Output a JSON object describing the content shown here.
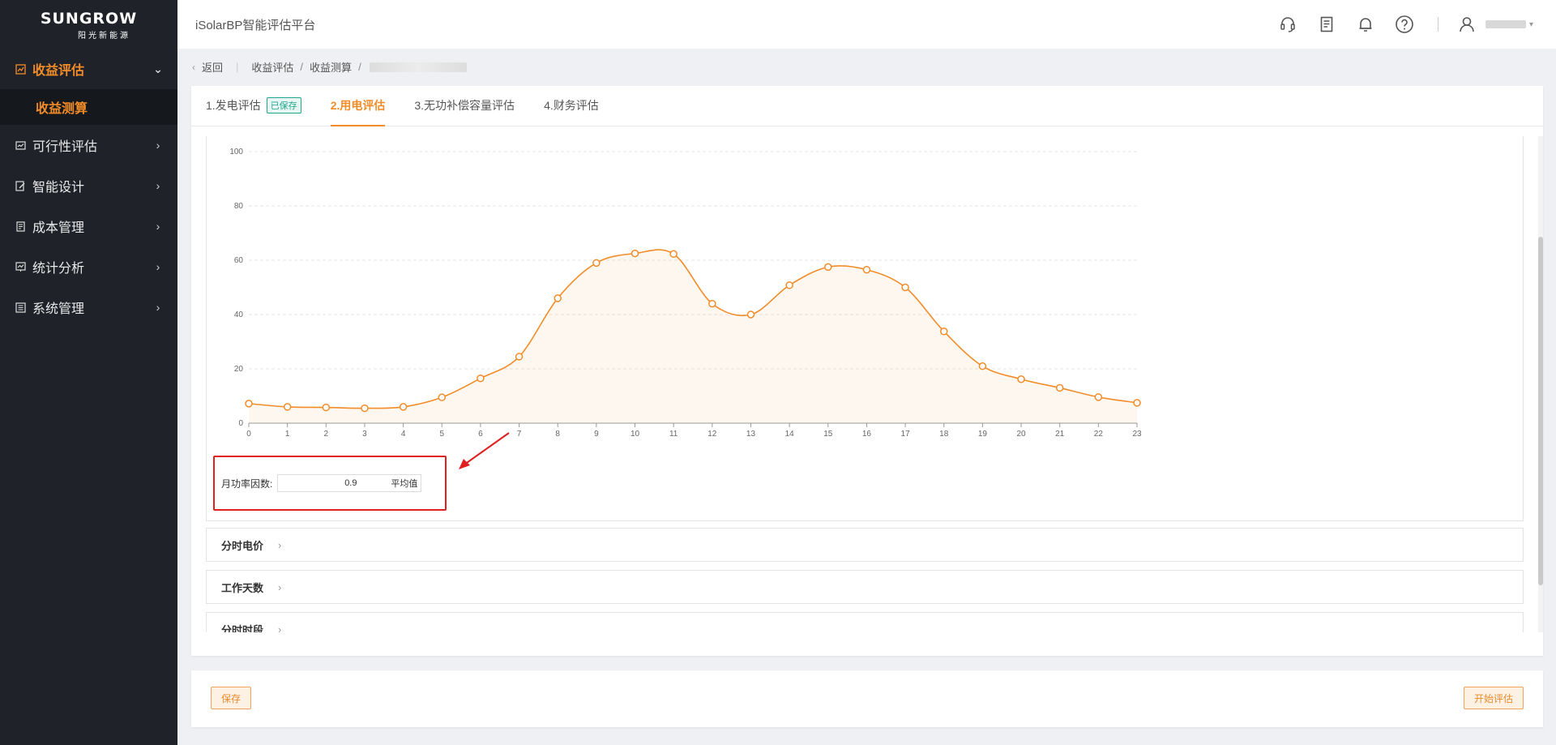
{
  "brand": {
    "name": "SUNGROW",
    "subtitle": "阳光新能源"
  },
  "app": {
    "title": "iSolarBP智能评估平台"
  },
  "sidebar": {
    "items": [
      {
        "label": "收益评估",
        "icon": "chart-icon",
        "active": true,
        "expanded": true
      },
      {
        "label": "可行性评估",
        "icon": "feasibility-icon"
      },
      {
        "label": "智能设计",
        "icon": "design-icon"
      },
      {
        "label": "成本管理",
        "icon": "cost-icon"
      },
      {
        "label": "统计分析",
        "icon": "stats-icon"
      },
      {
        "label": "系统管理",
        "icon": "settings-icon"
      }
    ],
    "subitem": {
      "label": "收益测算"
    }
  },
  "breadcrumb": {
    "back": "返回",
    "path": [
      "收益评估",
      "收益测算"
    ]
  },
  "tabs": [
    {
      "label": "1.发电评估",
      "badge": "已保存"
    },
    {
      "label": "2.用电评估",
      "active": true
    },
    {
      "label": "3.无功补偿容量评估"
    },
    {
      "label": "4.财务评估"
    }
  ],
  "power_factor": {
    "label": "月功率因数:",
    "value": "0.9",
    "unit": "平均值"
  },
  "sections": [
    {
      "label": "分时电价"
    },
    {
      "label": "工作天数"
    },
    {
      "label": "分时时段"
    }
  ],
  "footer": {
    "save": "保存",
    "start": "开始评估"
  },
  "colors": {
    "accent": "#f28c28",
    "sidebar_bg": "#1f2329",
    "highlight": "#e02020"
  },
  "chart_data": {
    "type": "area",
    "x": [
      0,
      1,
      2,
      3,
      4,
      5,
      6,
      7,
      8,
      9,
      10,
      11,
      12,
      13,
      14,
      15,
      16,
      17,
      18,
      19,
      20,
      21,
      22,
      23
    ],
    "series": [
      {
        "values": [
          7.2,
          6.0,
          5.8,
          5.5,
          6.0,
          9.5,
          16.5,
          24.5,
          46,
          59,
          62.5,
          62.3,
          44,
          40,
          50.8,
          57.5,
          56.5,
          50,
          33.8,
          21,
          16.2,
          13,
          9.6,
          7.5
        ]
      }
    ],
    "yticks": [
      0,
      20,
      40,
      60,
      80,
      100
    ],
    "ylim": [
      0,
      100
    ],
    "xlim": [
      0,
      23
    ],
    "grid": true,
    "color": "#f28c28"
  }
}
